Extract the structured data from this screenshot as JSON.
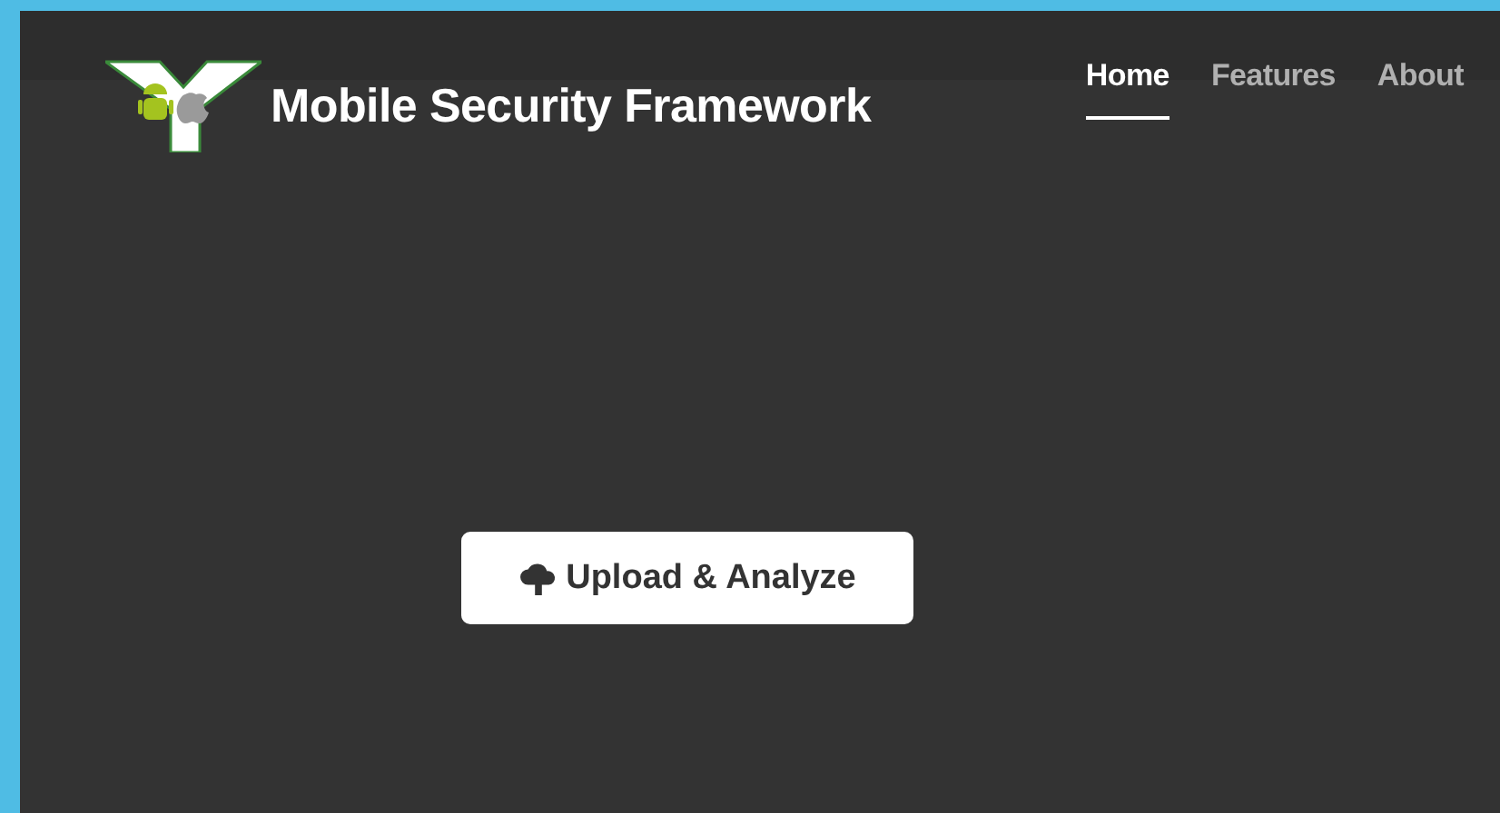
{
  "brand": {
    "title": "Mobile Security Framework"
  },
  "nav": [
    {
      "label": "Home",
      "selected": true
    },
    {
      "label": "Features",
      "selected": false
    },
    {
      "label": "About",
      "selected": false
    }
  ],
  "upload_button": {
    "label": "Upload & Analyze"
  }
}
